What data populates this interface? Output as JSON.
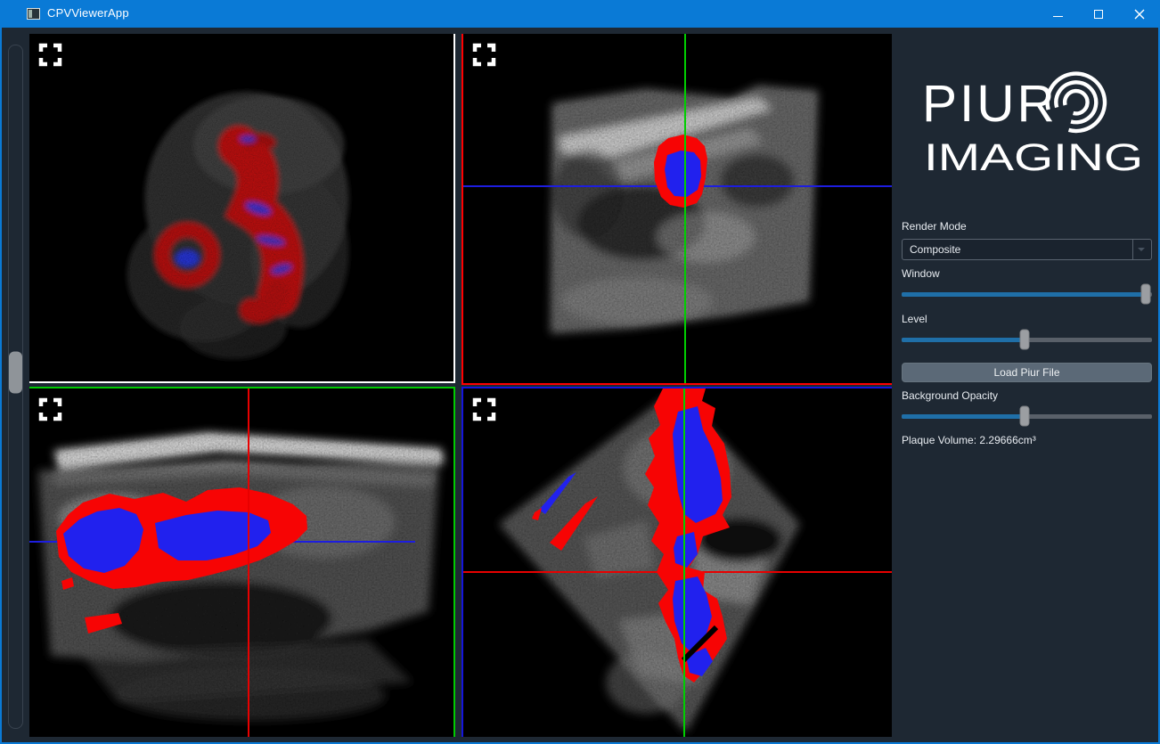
{
  "titlebar": {
    "title": "CPVViewerApp"
  },
  "sidebar": {
    "logo": {
      "word1": "PIUR",
      "word2": "IMAGING"
    },
    "render_mode_label": "Render Mode",
    "render_mode_value": "Composite",
    "window_label": "Window",
    "window_value_pct": 97.5,
    "level_label": "Level",
    "level_value_pct": 49,
    "load_button_label": "Load Piur File",
    "bg_opacity_label": "Background Opacity",
    "bg_opacity_value_pct": 49,
    "plaque_volume_text": "Plaque Volume: 2.29666cm³"
  },
  "left_slider": {
    "value_pct": 48.3
  },
  "viewports": {
    "axial": {
      "crosshair_v_pct": 51.8,
      "crosshair_h_pct": 43.6
    },
    "longitudinal": {
      "crosshair_v_pct": 51.7,
      "crosshair_h_pct": 43.9,
      "crosshair_h_len_pct": 91
    },
    "coronal": {
      "crosshair_v_pct": 51.6,
      "crosshair_h_pct": 52.6
    }
  },
  "colors": {
    "titlebar_blue": "#0a7ad6",
    "slider_fill_blue": "#1f6fa8",
    "crosshair_red": "#e80000",
    "crosshair_green": "#00cf00",
    "crosshair_blue": "#1d1de0",
    "border_white": "#ffffff",
    "border_red": "#ff0000",
    "border_green": "#00cc00",
    "border_blue": "#1515dd",
    "segmentation_red": "#f70404",
    "segmentation_blue": "#2121ee"
  }
}
